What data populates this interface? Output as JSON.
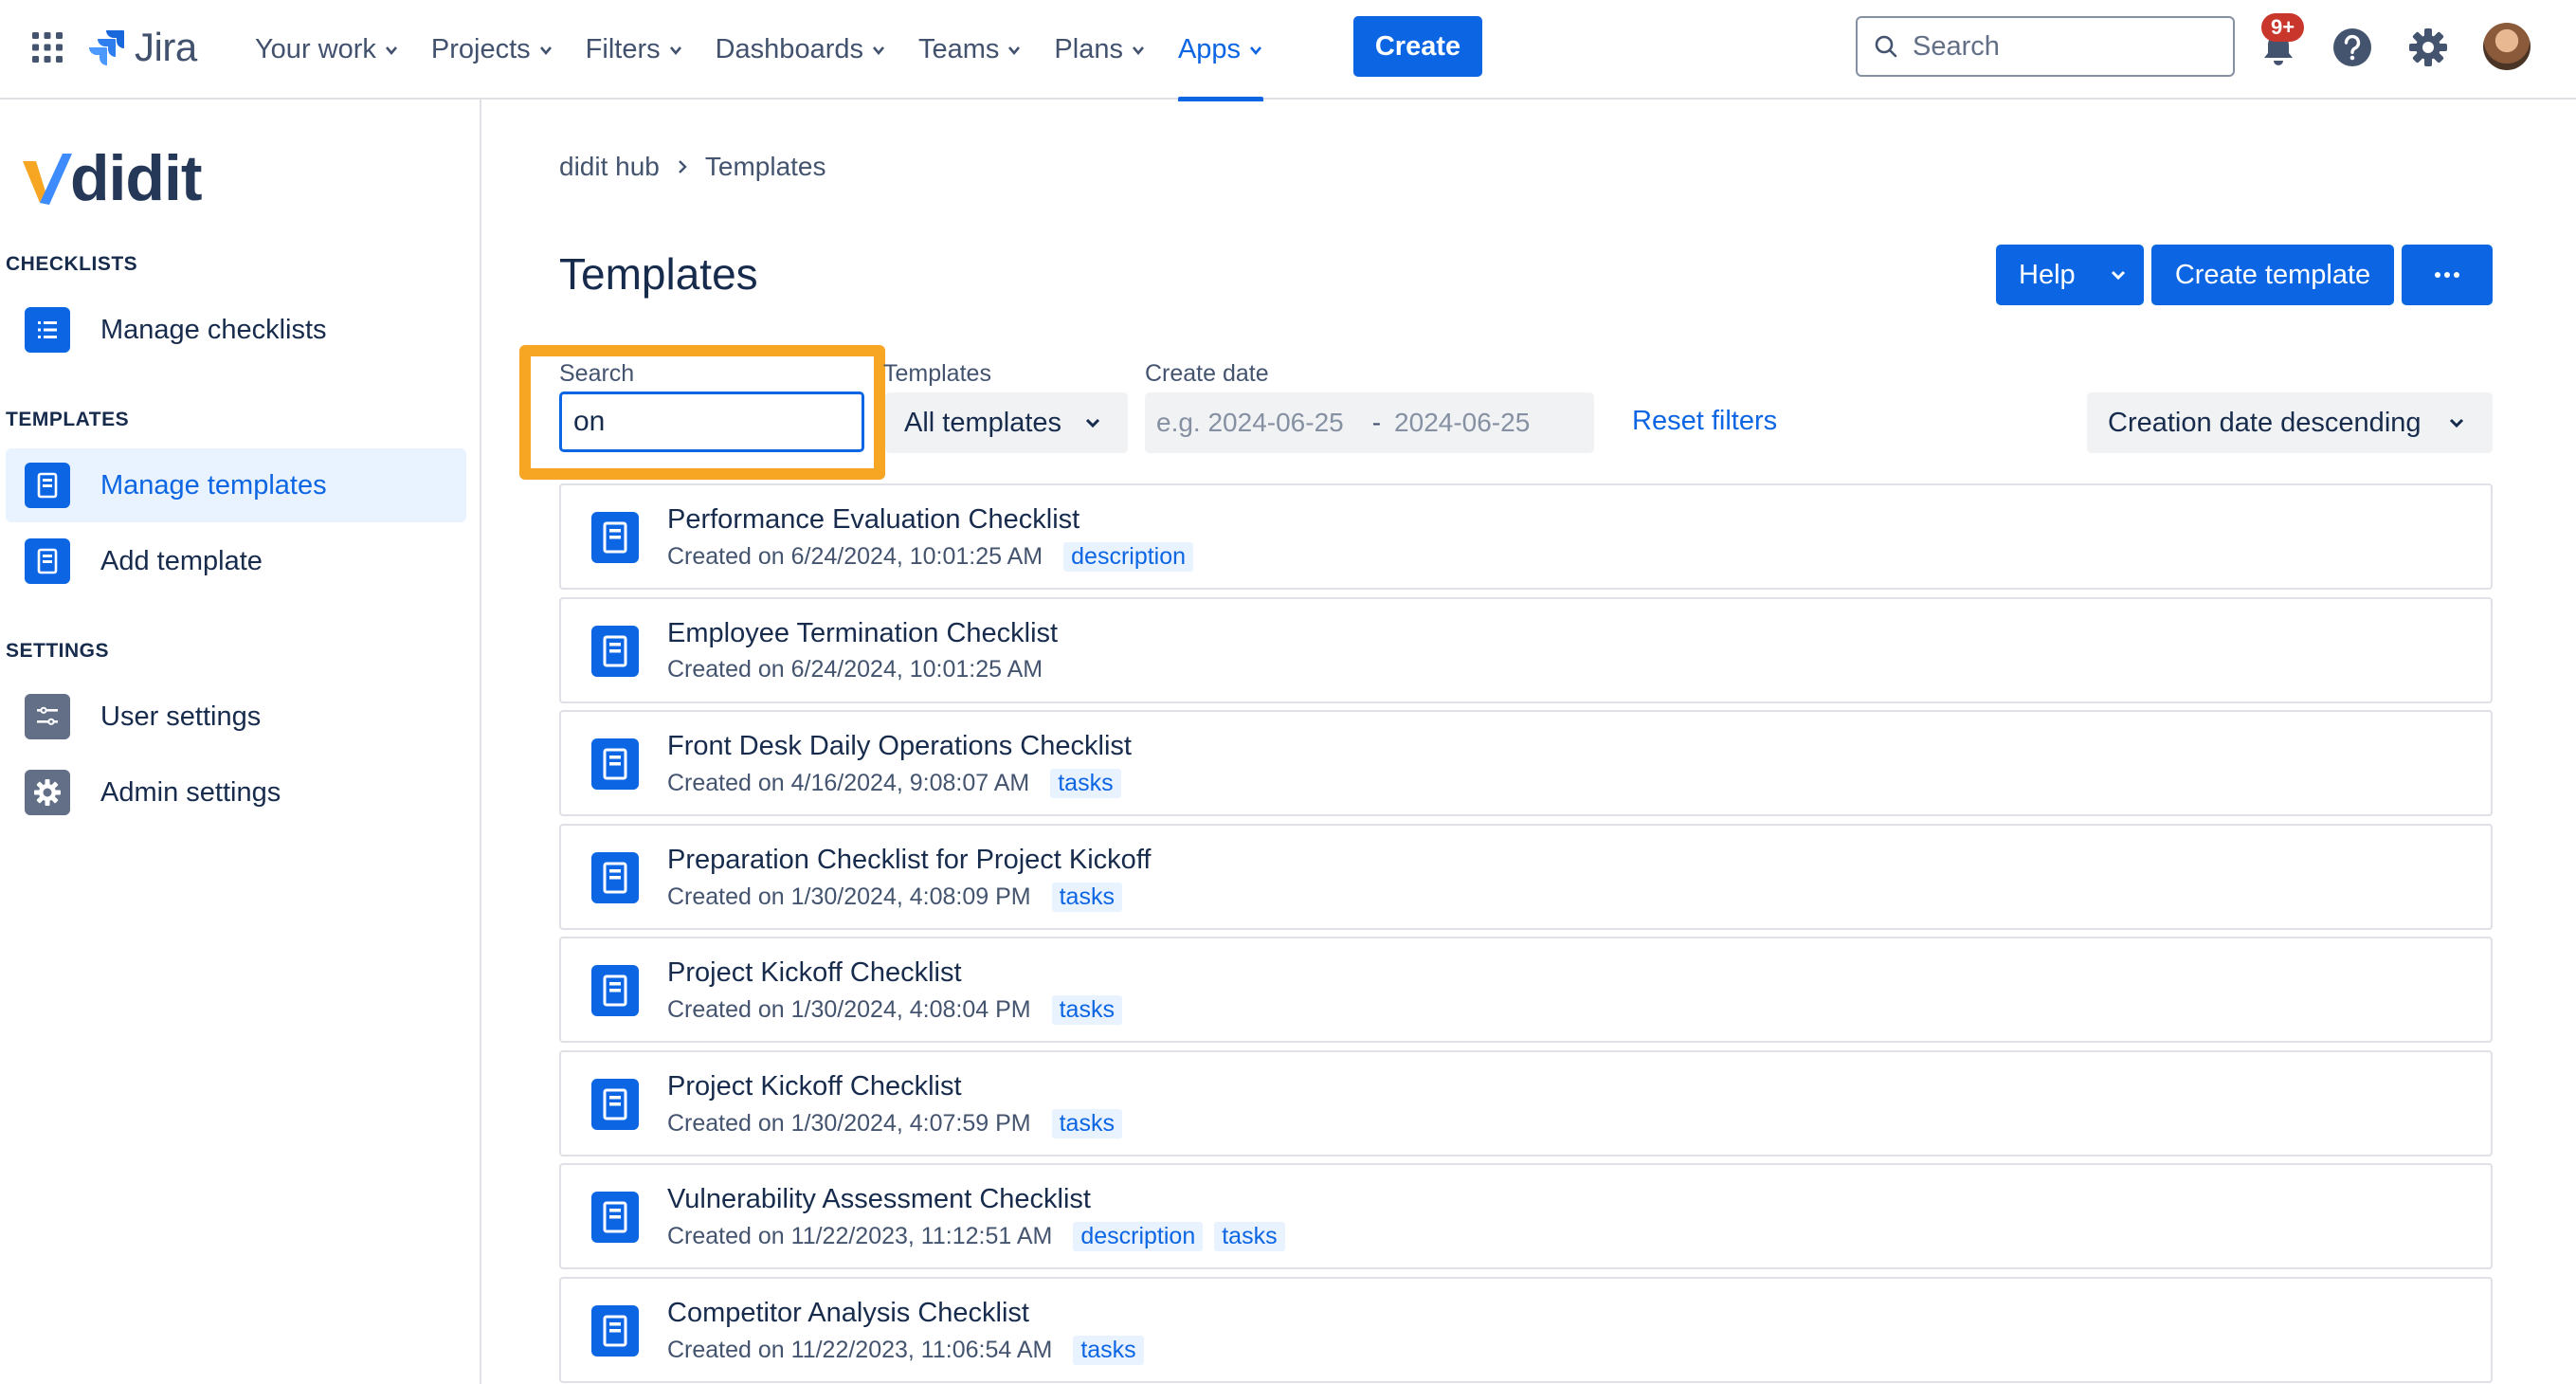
{
  "topnav": {
    "product": "Jira",
    "items": [
      {
        "label": "Your work",
        "active": false
      },
      {
        "label": "Projects",
        "active": false
      },
      {
        "label": "Filters",
        "active": false
      },
      {
        "label": "Dashboards",
        "active": false
      },
      {
        "label": "Teams",
        "active": false
      },
      {
        "label": "Plans",
        "active": false
      },
      {
        "label": "Apps",
        "active": true
      }
    ],
    "create_label": "Create",
    "search_placeholder": "Search",
    "notification_count": "9+",
    "icons": [
      "app-switcher-icon",
      "jira-logo-icon",
      "search-icon",
      "bell-icon",
      "help-icon",
      "gear-icon",
      "avatar"
    ],
    "accent": "#0c66e4"
  },
  "sidebar": {
    "brand": "didit",
    "sections": [
      {
        "title": "CHECKLISTS",
        "items": [
          {
            "label": "Manage checklists",
            "icon": "list-icon",
            "active": false
          }
        ]
      },
      {
        "title": "TEMPLATES",
        "items": [
          {
            "label": "Manage templates",
            "icon": "template-icon",
            "active": true
          },
          {
            "label": "Add template",
            "icon": "template-icon",
            "active": false
          }
        ]
      },
      {
        "title": "SETTINGS",
        "items": [
          {
            "label": "User settings",
            "icon": "sliders-icon",
            "active": false
          },
          {
            "label": "Admin settings",
            "icon": "gear-icon",
            "active": false
          }
        ]
      }
    ]
  },
  "main": {
    "breadcrumb": [
      "didit hub",
      "Templates"
    ],
    "title": "Templates",
    "buttons": {
      "help": "Help",
      "create_template": "Create template",
      "more": "more-icon"
    },
    "filters": {
      "search_label": "Search",
      "search_value": "on",
      "templates_label": "Templates",
      "templates_value": "All templates",
      "date_label": "Create date",
      "date_from_placeholder": "e.g. 2024-06-25",
      "date_separator": "-",
      "date_to_placeholder": "2024-06-25",
      "reset": "Reset filters",
      "sort_value": "Creation date descending"
    },
    "highlight_color": "#f6a623",
    "templates": [
      {
        "title": "Performance Evaluation Checklist",
        "created": "Created on 6/24/2024, 10:01:25 AM",
        "tags": [
          "description"
        ]
      },
      {
        "title": "Employee Termination Checklist",
        "created": "Created on 6/24/2024, 10:01:25 AM",
        "tags": []
      },
      {
        "title": "Front Desk Daily Operations Checklist",
        "created": "Created on 4/16/2024, 9:08:07 AM",
        "tags": [
          "tasks"
        ]
      },
      {
        "title": "Preparation Checklist for Project Kickoff",
        "created": "Created on 1/30/2024, 4:08:09 PM",
        "tags": [
          "tasks"
        ]
      },
      {
        "title": "Project Kickoff Checklist",
        "created": "Created on 1/30/2024, 4:08:04 PM",
        "tags": [
          "tasks"
        ]
      },
      {
        "title": "Project Kickoff Checklist",
        "created": "Created on 1/30/2024, 4:07:59 PM",
        "tags": [
          "tasks"
        ]
      },
      {
        "title": "Vulnerability Assessment Checklist",
        "created": "Created on 11/22/2023, 11:12:51 AM",
        "tags": [
          "description",
          "tasks"
        ]
      },
      {
        "title": "Competitor Analysis Checklist",
        "created": "Created on 11/22/2023, 11:06:54 AM",
        "tags": [
          "tasks"
        ]
      }
    ]
  }
}
